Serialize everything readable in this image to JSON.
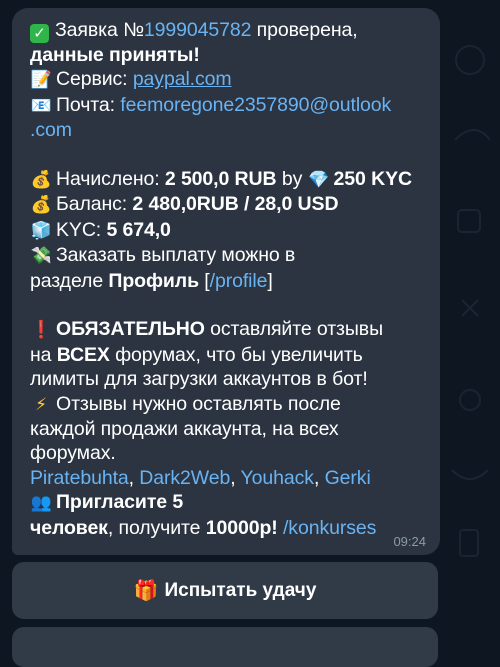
{
  "colors": {
    "background": "#0e1621",
    "bubble": "#2b3440",
    "button": "#313a47",
    "link": "#6ab3f3",
    "time": "#8d9aa7"
  },
  "icons": {
    "check": "check-mark-button-icon",
    "memo": "memo-icon",
    "email": "envelope-icon",
    "money_bag": "money-bag-icon",
    "diamond": "gem-stone-icon",
    "ice": "ice-cube-icon",
    "money_wings": "money-with-wings-icon",
    "exclamation": "red-exclamation-icon",
    "zap": "high-voltage-icon",
    "people": "busts-icon",
    "gift": "gift-icon"
  },
  "message": {
    "l1_pre": "Заявка №",
    "l1_id": "1999045782",
    "l1_post": " проверена,",
    "l2": "данные приняты!",
    "service_label": "Сервис: ",
    "service_value": "paypal.com",
    "mail_label": "Почта: ",
    "mail_value_1": "feemoregone2357890@outlook",
    "mail_value_2": ".com",
    "accrued_label": "Начислено: ",
    "accrued_value": "2 500,0 RUB",
    "accrued_by": " by ",
    "accrued_kyc": "250 KYC",
    "balance_label": "Баланс: ",
    "balance_value": "2 480,0RUB  / 28,0 USD",
    "kyc_label": "KYC: ",
    "kyc_value": "5 674,0",
    "payout_line1": "Заказать выплату можно в",
    "payout_line2_pre": "разделе ",
    "payout_profile": "Профиль",
    "payout_bracket_open": " [",
    "payout_link": "/profile",
    "payout_bracket_close": "]",
    "required_word": "ОБЯЗАТЕЛЬНО",
    "required_rest": " оставляйте отзывы",
    "forums_pre": "на ",
    "forums_all": "ВСЕХ",
    "forums_post": " форумах, что бы увеличить",
    "limits_line": "лимиты для загрузки аккаунтов в бот!",
    "reviews_line1": "Отзывы нужно оставлять после",
    "reviews_line2": "каждой продажи аккаунта, на всех",
    "reviews_line3": "форумах.",
    "forum_links": [
      "Piratebuhta",
      "Dark2Web",
      "Youhack",
      "Gerki"
    ],
    "comma": ", ",
    "invite_bold": "Пригласите 5",
    "invite_bold2": "человек",
    "invite_rest": ", получите ",
    "invite_reward": "10000р!",
    "invite_cmd": "/konkurses",
    "time": "09:24"
  },
  "button": {
    "label": "Испытать удачу"
  }
}
